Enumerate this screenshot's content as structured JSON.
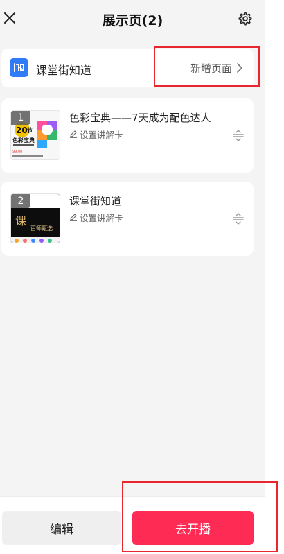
{
  "header": {
    "title": "展示页(2)"
  },
  "channel": {
    "logo_text": "i",
    "name": "课堂街知道",
    "new_page_label": "新增页面"
  },
  "pages": [
    {
      "index": "1",
      "title": "色彩宝典——7天成为配色达人",
      "explain_label": "设置讲解卡",
      "thumb_text": [
        "20",
        "节",
        "色彩宝典",
        "99.00"
      ]
    },
    {
      "index": "2",
      "title": "课堂街知道",
      "explain_label": "设置讲解卡",
      "thumb_text": [
        "课",
        "百师甄选"
      ]
    }
  ],
  "footer": {
    "edit_label": "编辑",
    "start_label": "去开播"
  },
  "colors": {
    "accent": "#fe2c55",
    "logo_blue": "#2f7cf6",
    "highlight_red": "#e8262e",
    "background": "#f4f4f4"
  }
}
